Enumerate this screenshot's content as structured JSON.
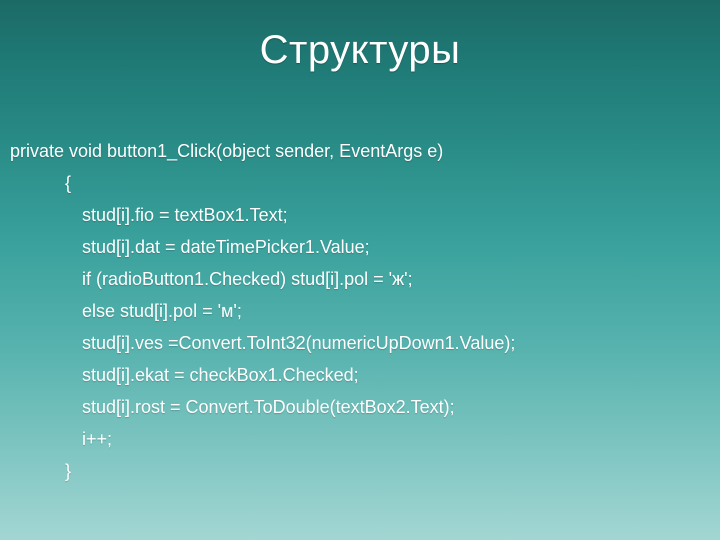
{
  "title": "Структуры",
  "code": {
    "l0": "private void button1_Click(object sender, EventArgs e)",
    "l1": "{",
    "l2": "stud[i].fio = textBox1.Text;",
    "l3": "stud[i].dat = dateTimePicker1.Value;",
    "l4": "if (radioButton1.Checked) stud[i].pol = 'ж';",
    "l5": "else stud[i].pol = 'м';",
    "l6": "stud[i].ves =Convert.ToInt32(numericUpDown1.Value);",
    "l7": "stud[i].ekat = checkBox1.Checked;",
    "l8": "stud[i].rost = Convert.ToDouble(textBox2.Text);",
    "l9": "i++;",
    "l10": "}"
  }
}
